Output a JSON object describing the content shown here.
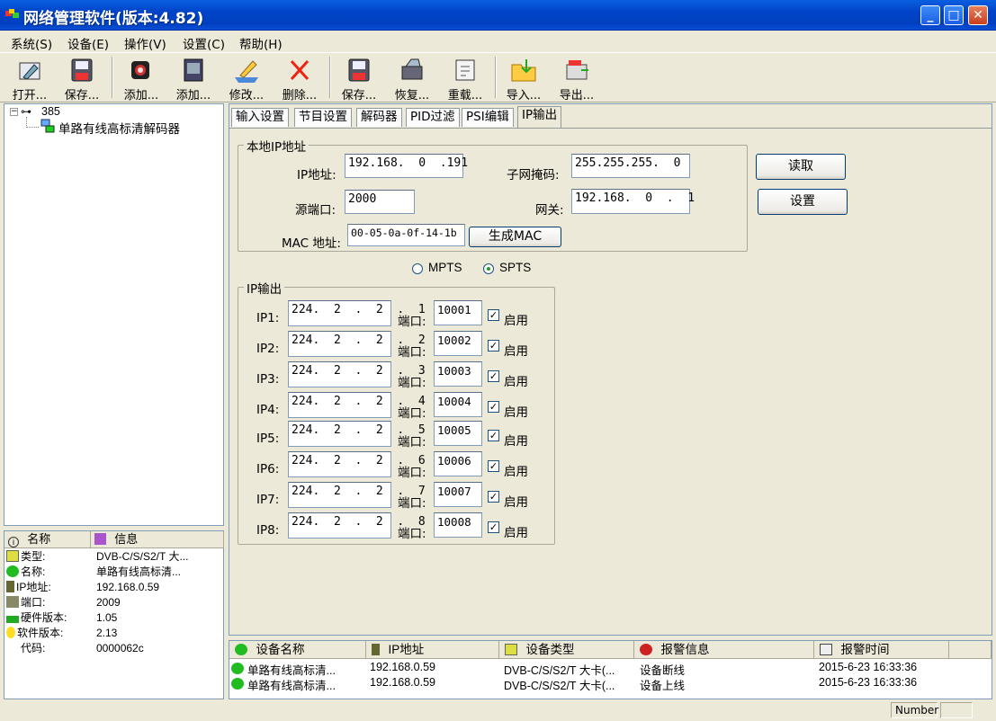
{
  "window": {
    "title": "网络管理软件(版本:4.82)"
  },
  "menu": [
    "系统(S)",
    "设备(E)",
    "操作(V)",
    "设置(C)",
    "帮助(H)"
  ],
  "toolbar": [
    "打开...",
    "保存...",
    "添加...",
    "添加...",
    "修改...",
    "删除...",
    "保存...",
    "恢复...",
    "重载...",
    "导入...",
    "导出..."
  ],
  "tree": {
    "root": "385",
    "child": "单路有线高标清解码器"
  },
  "info": {
    "headers": [
      "名称",
      "信息"
    ],
    "rows": [
      {
        "name": "类型:",
        "value": "DVB-C/S/S2/T 大..."
      },
      {
        "name": "名称:",
        "value": "单路有线高标清..."
      },
      {
        "name": "IP地址:",
        "value": "192.168.0.59"
      },
      {
        "name": "端口:",
        "value": "2009"
      },
      {
        "name": "硬件版本:",
        "value": "1.05"
      },
      {
        "name": "软件版本:",
        "value": "2.13"
      },
      {
        "name": "代码:",
        "value": "0000062c"
      }
    ]
  },
  "tabs": [
    "输入设置",
    "节目设置",
    "解码器",
    "PID过滤",
    "PSI编辑",
    "IP输出"
  ],
  "local": {
    "group_title": "本地IP地址",
    "ip_label": "IP地址:",
    "ip_value": "192.168.  0  .191",
    "mask_label": "子网掩码:",
    "mask_value": "255.255.255.  0",
    "port_label": "源端口:",
    "port_value": "2000",
    "gw_label": "网关:",
    "gw_value": "192.168.  0  .  1",
    "mac_label": "MAC 地址:",
    "mac_value": "00-05-0a-0f-14-1b",
    "gen_mac": "生成MAC",
    "read": "读取",
    "set": "设置"
  },
  "mode": {
    "mpts": "MPTS",
    "spts": "SPTS",
    "selected": "SPTS"
  },
  "output": {
    "group_title": "IP输出",
    "port_label": "端口:",
    "enable_label": "启用",
    "rows": [
      {
        "label": "IP1:",
        "ip": "224.  2  .  2  .  1",
        "port": "10001",
        "enabled": true
      },
      {
        "label": "IP2:",
        "ip": "224.  2  .  2  .  2",
        "port": "10002",
        "enabled": true
      },
      {
        "label": "IP3:",
        "ip": "224.  2  .  2  .  3",
        "port": "10003",
        "enabled": true
      },
      {
        "label": "IP4:",
        "ip": "224.  2  .  2  .  4",
        "port": "10004",
        "enabled": true
      },
      {
        "label": "IP5:",
        "ip": "224.  2  .  2  .  5",
        "port": "10005",
        "enabled": true
      },
      {
        "label": "IP6:",
        "ip": "224.  2  .  2  .  6",
        "port": "10006",
        "enabled": true
      },
      {
        "label": "IP7:",
        "ip": "224.  2  .  2  .  7",
        "port": "10007",
        "enabled": true
      },
      {
        "label": "IP8:",
        "ip": "224.  2  .  2  .  8",
        "port": "10008",
        "enabled": true
      }
    ]
  },
  "alarms": {
    "headers": [
      "设备名称",
      "IP地址",
      "设备类型",
      "报警信息",
      "报警时间"
    ],
    "rows": [
      [
        "单路有线高标清...",
        "192.168.0.59",
        "DVB-C/S/S2/T 大卡(...",
        "设备断线",
        "2015-6-23 16:33:36"
      ],
      [
        "单路有线高标清...",
        "192.168.0.59",
        "DVB-C/S/S2/T 大卡(...",
        "设备上线",
        "2015-6-23 16:33:36"
      ]
    ]
  },
  "status": {
    "number": "Number"
  },
  "colors": {
    "titlebar": "#0043c7",
    "face": "#ece9d8",
    "border": "#7f9db9"
  }
}
